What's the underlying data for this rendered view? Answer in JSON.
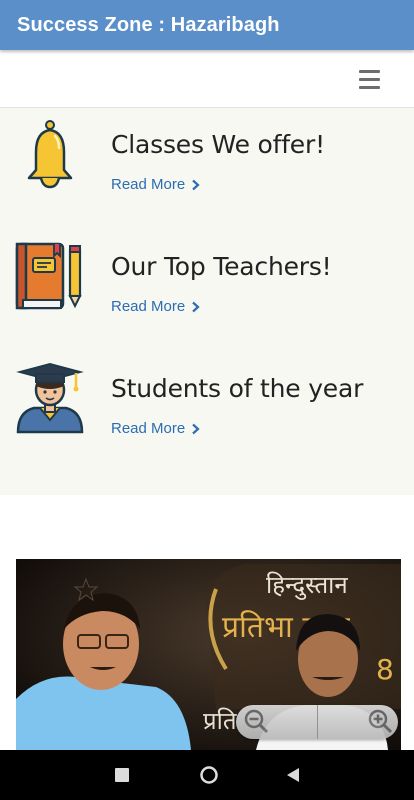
{
  "appbar": {
    "title": "Success Zone : Hazaribagh"
  },
  "navbar": {
    "menu_icon": "hamburger-menu-icon"
  },
  "features": [
    {
      "title": "Classes We offer!",
      "link_label": "Read More",
      "icon": "bell-icon"
    },
    {
      "title": "Our Top Teachers!",
      "link_label": "Read More",
      "icon": "book-and-pencil-icon"
    },
    {
      "title": "Students of the year",
      "link_label": "Read More",
      "icon": "graduate-student-icon"
    }
  ],
  "photo": {
    "banner_line1": "हिन्दुस्तान",
    "banner_line2": "प्रतिभा सम्म",
    "banner_number": "8",
    "banner_fragment": "प्रति"
  },
  "zoom_control": {
    "zoom_out_icon": "zoom-out-icon",
    "zoom_in_icon": "zoom-in-icon"
  },
  "system_nav": {
    "recents": "square-icon",
    "home": "circle-icon",
    "back": "triangle-back-icon"
  },
  "colors": {
    "appbar": "#5b8fc9",
    "link": "#2b6db2",
    "section_bg": "#f8f8f3"
  }
}
